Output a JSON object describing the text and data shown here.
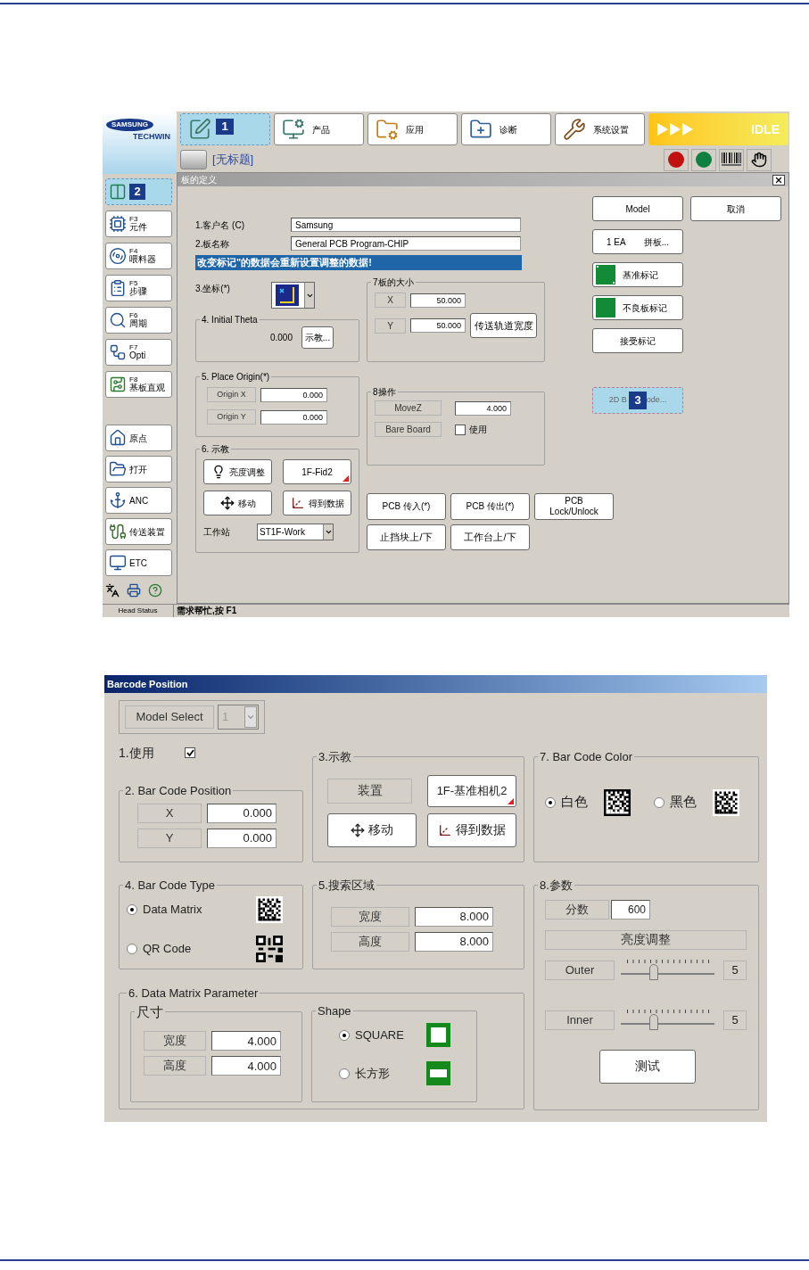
{
  "main_window": {
    "logo": {
      "brand": "SAMSUNG",
      "sub": "TECHWIN"
    },
    "top_tabs": [
      {
        "kind": "edit",
        "badge": "1",
        "selected": true
      },
      {
        "kind": "product",
        "label": "产品",
        "selected": false
      },
      {
        "kind": "apply",
        "label": "应用",
        "selected": false
      },
      {
        "kind": "diagnose",
        "label": "诊断",
        "selected": false
      },
      {
        "kind": "system",
        "label": "系统设置",
        "selected": false
      }
    ],
    "run_status": {
      "label": "IDLE"
    },
    "document_title": "[无标题]",
    "sidebar": [
      {
        "kind": "board",
        "badge": "2",
        "selected": true
      },
      {
        "kind": "parts",
        "key": "F3",
        "label": "元件",
        "selected": false
      },
      {
        "kind": "feeder",
        "key": "F4",
        "label": "喂料器",
        "selected": false
      },
      {
        "kind": "steps",
        "key": "F5",
        "label": "步骤",
        "selected": false
      },
      {
        "kind": "cycle",
        "key": "F6",
        "label": "周期",
        "selected": false
      },
      {
        "kind": "opti",
        "key": "F7",
        "label": "Opti",
        "selected": false
      },
      {
        "kind": "view",
        "key": "F8",
        "label": "基板直观",
        "selected": false
      }
    ],
    "sidebar_actions": [
      {
        "kind": "home",
        "label": "原点"
      },
      {
        "kind": "open",
        "label": "打开"
      },
      {
        "kind": "anc",
        "label": "ANC"
      },
      {
        "kind": "conveyor",
        "label": "传送装置"
      },
      {
        "kind": "etc",
        "label": "ETC"
      }
    ],
    "panel": {
      "title": "板的定义",
      "fields": [
        {
          "label": "1.客户名 (C)",
          "value": "Samsung"
        },
        {
          "label": "2.板名称",
          "value": "General PCB Program-CHIP"
        }
      ],
      "warning": "改变标记\"的数据会重新设置调整的数据!",
      "coordinate_label": "3.坐标(*)",
      "initial_theta": {
        "title": "4. Initial Theta",
        "value": "0.000",
        "button": "示教..."
      },
      "place_origin": {
        "title": "5. Place Origin(*)",
        "rows": [
          {
            "label": "Origin X",
            "value": "0.000"
          },
          {
            "label": "Origin Y",
            "value": "0.000"
          }
        ]
      },
      "teach": {
        "title": "6. 示教",
        "buttons": [
          {
            "kind": "brightness",
            "label": "亮度调整"
          },
          {
            "kind": "camera",
            "label": "1F-Fid2"
          },
          {
            "kind": "move",
            "label": "移动"
          },
          {
            "kind": "get_data",
            "label": "得到数据"
          }
        ],
        "station_label": "工作站",
        "station": "ST1F-Work"
      },
      "board_size": {
        "title": "7板的大小",
        "rows": [
          {
            "label": "X",
            "value": "50.000"
          },
          {
            "label": "Y",
            "value": "50.000"
          }
        ],
        "button": "传送轨道宽度"
      },
      "operation": {
        "title": "8操作",
        "movez_label": "MoveZ",
        "movez": "4.000",
        "bare_board_label": "Bare Board",
        "use": {
          "label": "使用",
          "checked": false
        }
      },
      "conveyor_buttons": [
        "PCB 传入(*)",
        "PCB 传出(*)",
        "PCB Lock/Unlock"
      ],
      "table_buttons": [
        "止挡块上/下",
        "工作台上/下"
      ],
      "model_row": [
        "Model",
        "取消"
      ],
      "side_buttons": [
        {
          "kind": "split",
          "left": "1 EA",
          "right": "拼板..."
        },
        {
          "kind": "fiducial",
          "label": "基准标记"
        },
        {
          "kind": "mark",
          "label": "不良板标记"
        },
        {
          "kind": "plain",
          "label": "接受标记"
        }
      ],
      "barcode_button": {
        "label_start": "2D B",
        "badge": "3",
        "label_end": "ode..."
      }
    },
    "status_bar": {
      "head": "Head Status",
      "message": "需求帮忙,按 F1"
    }
  },
  "barcode_dialog": {
    "title": "Barcode Position",
    "model_select": {
      "label": "Model Select",
      "value": "1",
      "disabled": true
    },
    "use": {
      "label": "1.使用",
      "checked": true
    },
    "position": {
      "title": "2. Bar Code Position",
      "rows": [
        {
          "label": "X",
          "value": "0.000"
        },
        {
          "label": "Y",
          "value": "0.000"
        }
      ]
    },
    "teach": {
      "title": "3.示教",
      "device_label": "装置",
      "camera": "1F-基准相机2",
      "move": "移动",
      "get_data": "得到数据"
    },
    "code_type": {
      "title": "4. Bar Code Type",
      "options": [
        {
          "kind": "data_matrix",
          "label": "Data Matrix",
          "selected": true
        },
        {
          "kind": "qr",
          "label": "QR Code",
          "selected": false
        }
      ]
    },
    "search_area": {
      "title": "5.搜索区域",
      "rows": [
        {
          "label": "宽度",
          "value": "8.000"
        },
        {
          "label": "高度",
          "value": "8.000"
        }
      ]
    },
    "dm_params": {
      "title": "6. Data Matrix Parameter",
      "size": {
        "title": "尺寸",
        "rows": [
          {
            "label": "宽度",
            "value": "4.000"
          },
          {
            "label": "高度",
            "value": "4.000"
          }
        ]
      },
      "shape": {
        "title": "Shape",
        "options": [
          {
            "kind": "square",
            "label": "SQUARE",
            "selected": true
          },
          {
            "kind": "rectangle",
            "label": "长方形",
            "selected": false
          }
        ]
      }
    },
    "color": {
      "title": "7. Bar Code Color",
      "options": [
        {
          "kind": "white",
          "label": "白色",
          "selected": true
        },
        {
          "kind": "black",
          "label": "黑色",
          "selected": false
        }
      ]
    },
    "params": {
      "title": "8.参数",
      "score_label": "分数",
      "score": "600",
      "brightness_label": "亮度调整",
      "sliders": [
        {
          "label": "Outer",
          "level": 0.35,
          "reading": "5"
        },
        {
          "label": "Inner",
          "level": 0.35,
          "reading": "5"
        }
      ],
      "test_button": "测试"
    }
  }
}
